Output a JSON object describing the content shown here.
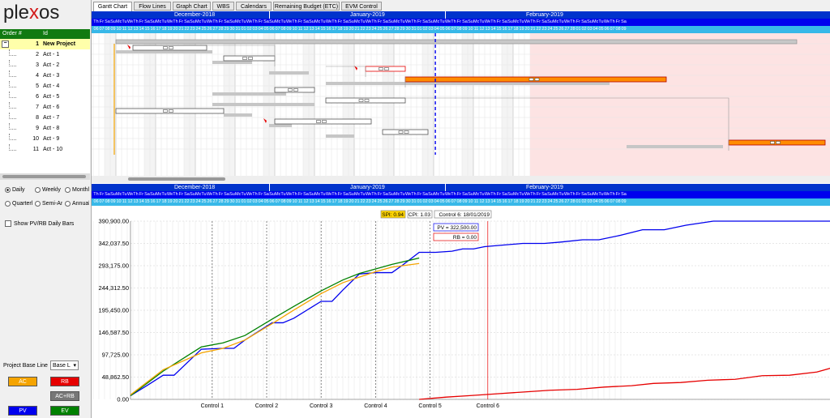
{
  "app": {
    "logo_text": "plexos",
    "logo_accent": "x"
  },
  "tabs": [
    {
      "label": "Gantt Chart",
      "active": true
    },
    {
      "label": "Flow Lines",
      "active": false
    },
    {
      "label": "Graph Chart",
      "active": false
    },
    {
      "label": "WBS",
      "active": false
    },
    {
      "label": "Calendars",
      "active": false
    },
    {
      "label": "Remaining Budget (ETC)",
      "active": false
    },
    {
      "label": "EVM Control",
      "active": false
    }
  ],
  "tree": {
    "header_order": "Order #",
    "header_id": "Id",
    "rows": [
      {
        "num": "1",
        "name": "New Project"
      },
      {
        "num": "2",
        "name": "Act - 1"
      },
      {
        "num": "3",
        "name": "Act - 2"
      },
      {
        "num": "4",
        "name": "Act - 3"
      },
      {
        "num": "5",
        "name": "Act - 4"
      },
      {
        "num": "6",
        "name": "Act - 5"
      },
      {
        "num": "7",
        "name": "Act - 6"
      },
      {
        "num": "8",
        "name": "Act - 7"
      },
      {
        "num": "9",
        "name": "Act - 8"
      },
      {
        "num": "10",
        "name": "Act - 9"
      },
      {
        "num": "11",
        "name": "Act - 10"
      }
    ]
  },
  "options": {
    "scales": [
      {
        "label": "Daily",
        "selected": true
      },
      {
        "label": "Weekly",
        "selected": false
      },
      {
        "label": "Monthly",
        "selected": false
      },
      {
        "label": "Quarterly",
        "selected": false
      },
      {
        "label": "Semi-Annual",
        "selected": false
      },
      {
        "label": "Annual",
        "selected": false
      }
    ],
    "show_daily_bars": "Show PV/RB Daily Bars",
    "base_line_label": "Project Base Line",
    "base_line_value": "Base L"
  },
  "legend_buttons": [
    {
      "label": "AC",
      "color": "#f5a400"
    },
    {
      "label": "RB",
      "color": "#e60000"
    },
    {
      "label": "AC+RB",
      "color": "#777777"
    },
    {
      "label": "PV",
      "color": "#0000ee"
    },
    {
      "label": "EV",
      "color": "#008000"
    }
  ],
  "timeline": {
    "months": [
      {
        "label": "December-2018",
        "start": 0
      },
      {
        "label": "January-2019",
        "start": 31
      },
      {
        "label": "February-2019",
        "start": 62
      }
    ],
    "dow": [
      "Th",
      "Fr",
      "Sa",
      "Su",
      "Mo",
      "Tu",
      "We"
    ],
    "dom": [
      "06",
      "07",
      "08",
      "09",
      "10",
      "11",
      "12",
      "13",
      "14",
      "15",
      "16",
      "17",
      "18",
      "19",
      "20",
      "21",
      "22",
      "23",
      "24",
      "25",
      "26",
      "27",
      "28",
      "29",
      "30",
      "31",
      "01",
      "02",
      "03",
      "04",
      "05",
      "06",
      "07",
      "08",
      "09",
      "10",
      "11",
      "12",
      "13",
      "14",
      "15",
      "16",
      "17",
      "18",
      "19",
      "20",
      "21",
      "22",
      "23",
      "24",
      "25",
      "26",
      "27",
      "28",
      "29",
      "30",
      "31",
      "01",
      "02",
      "03",
      "04",
      "05",
      "06",
      "07",
      "08",
      "09",
      "10",
      "11",
      "12",
      "13",
      "14",
      "15",
      "16",
      "17",
      "18",
      "19",
      "20",
      "21",
      "22",
      "23",
      "24",
      "25",
      "26",
      "27",
      "28",
      "01",
      "02",
      "03",
      "04",
      "05",
      "06",
      "07",
      "08",
      "09"
    ]
  },
  "annotations": {
    "spi": "SPI: 0.94",
    "cpi": "CPI: 1.03",
    "control": "Control 6: 18/01/2019",
    "pv": "PV = 322,500.00",
    "rb": "RB = 0.00"
  },
  "chart_data": {
    "type": "line",
    "y_ticks": [
      "0.00",
      "48,862.50",
      "97,725.00",
      "146,587.50",
      "195,450.00",
      "244,312.50",
      "293,175.00",
      "342,037.50",
      "390,900.00"
    ],
    "ylim": [
      0,
      390900
    ],
    "controls": [
      {
        "label": "Control 1",
        "day": 15
      },
      {
        "label": "Control 2",
        "day": 25
      },
      {
        "label": "Control 3",
        "day": 35
      },
      {
        "label": "Control 4",
        "day": 45
      },
      {
        "label": "Control 5",
        "day": 55
      },
      {
        "label": "Control 6",
        "day": 65
      }
    ],
    "series": [
      {
        "name": "PV",
        "color": "#0000ee",
        "x": [
          0,
          3,
          6,
          8,
          13,
          17,
          19,
          21,
          26,
          28,
          30,
          35,
          37,
          39,
          42,
          45,
          48,
          50,
          53,
          56,
          59,
          61,
          63,
          65,
          68,
          72,
          76,
          79,
          83,
          86,
          90,
          94,
          98,
          102,
          107,
          112,
          117,
          121,
          126,
          131
        ],
        "y": [
          8000,
          30000,
          53000,
          53000,
          110000,
          112000,
          112000,
          130000,
          168000,
          168000,
          178000,
          215000,
          215000,
          240000,
          275000,
          278000,
          278000,
          295000,
          322500,
          322500,
          325000,
          330000,
          330000,
          335000,
          338000,
          342000,
          342000,
          345000,
          350000,
          350000,
          360000,
          372000,
          372000,
          382000,
          390900,
          390900,
          390900,
          390900,
          390900,
          390900
        ]
      },
      {
        "name": "EV",
        "color": "#008000",
        "x": [
          0,
          3,
          6,
          13,
          17,
          21,
          26,
          30,
          35,
          39,
          42,
          45,
          48,
          53
        ],
        "y": [
          8000,
          35000,
          62000,
          115000,
          124000,
          140000,
          176000,
          204000,
          238000,
          262000,
          276000,
          286000,
          296000,
          310000
        ]
      },
      {
        "name": "AC",
        "color": "#f5a400",
        "x": [
          0,
          6,
          13,
          17,
          21,
          26,
          30,
          35,
          39,
          42,
          45,
          48,
          53
        ],
        "y": [
          10000,
          65000,
          102000,
          112000,
          130000,
          166000,
          196000,
          232000,
          256000,
          268000,
          280000,
          290000,
          298000
        ]
      },
      {
        "name": "RB",
        "color": "#e60000",
        "x": [
          53,
          58,
          62,
          67,
          72,
          77,
          82,
          87,
          92,
          96,
          101,
          106,
          111,
          116,
          121,
          126,
          129,
          131
        ],
        "y": [
          0,
          5000,
          8000,
          12000,
          16000,
          20000,
          22000,
          27000,
          30000,
          35000,
          37000,
          42000,
          44000,
          52000,
          53000,
          60000,
          70000,
          70000
        ]
      }
    ]
  }
}
